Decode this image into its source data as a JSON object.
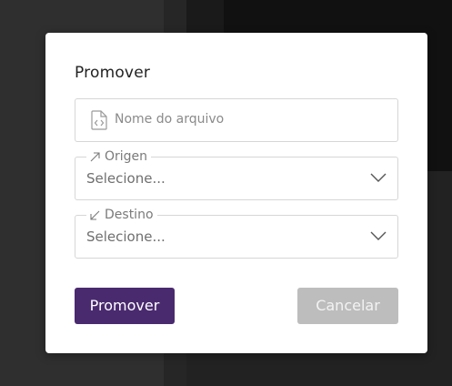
{
  "modal": {
    "title": "Promover",
    "file_field": {
      "placeholder": "Nome do arquivo",
      "icon": "file-code-icon"
    },
    "origem": {
      "label": "Origen",
      "icon": "arrow-up-right-icon",
      "value": "Selecione..."
    },
    "destino": {
      "label": "Destino",
      "icon": "arrow-down-left-icon",
      "value": "Selecione..."
    },
    "buttons": {
      "promote": "Promover",
      "cancel": "Cancelar"
    }
  },
  "colors": {
    "primary": "#4a2a6f",
    "disabled": "#bdbdbd"
  }
}
